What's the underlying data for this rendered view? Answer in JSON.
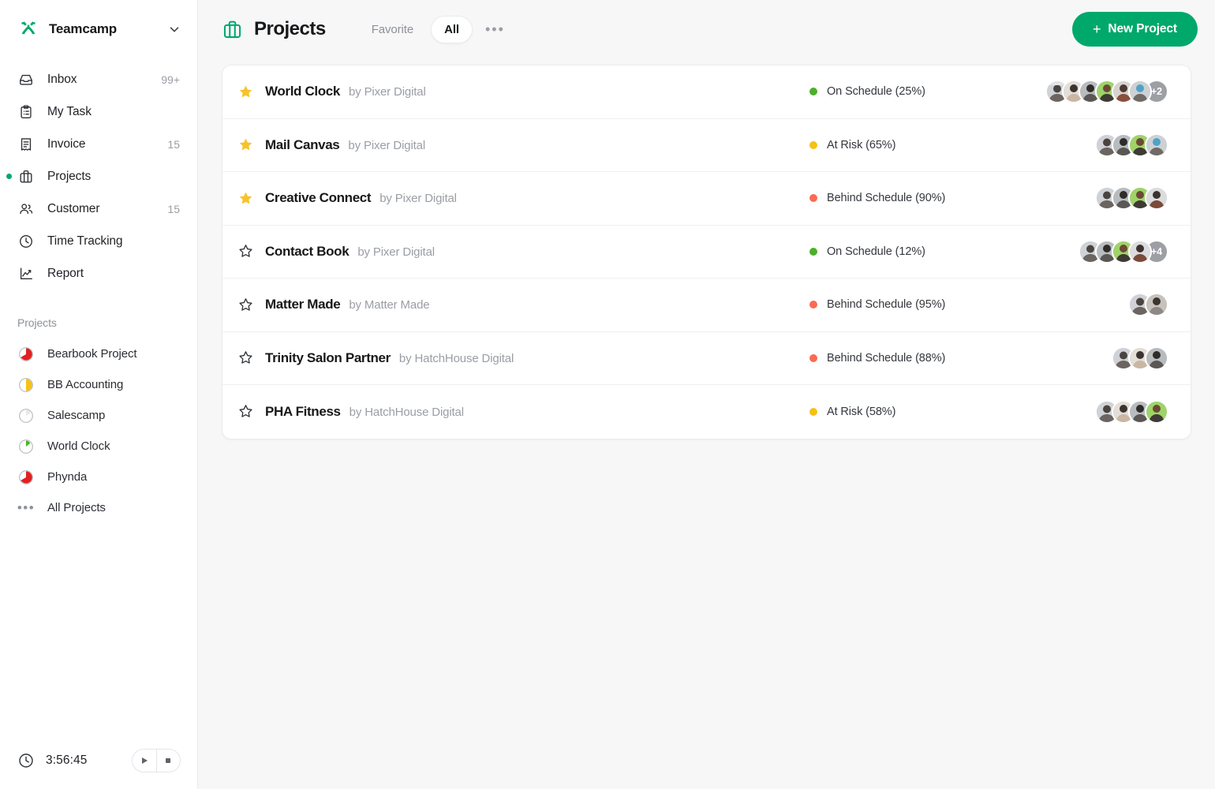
{
  "brand": {
    "name": "Teamcamp",
    "logo_icon": "teamcamp-logo-icon",
    "caret_icon": "chevron-down-icon"
  },
  "sidebar": {
    "nav": [
      {
        "label": "Inbox",
        "icon": "inbox-icon",
        "badge": "99+",
        "active": false
      },
      {
        "label": "My Task",
        "icon": "clipboard-icon",
        "badge": "",
        "active": false
      },
      {
        "label": "Invoice",
        "icon": "receipt-icon",
        "badge": "15",
        "active": false
      },
      {
        "label": "Projects",
        "icon": "briefcase-icon",
        "badge": "",
        "active": true
      },
      {
        "label": "Customer",
        "icon": "people-icon",
        "badge": "15",
        "active": false
      },
      {
        "label": "Time Tracking",
        "icon": "clock-icon",
        "badge": "",
        "active": false
      },
      {
        "label": "Report",
        "icon": "chart-line-icon",
        "badge": "",
        "active": false
      }
    ],
    "projects_section_title": "Projects",
    "projects": [
      {
        "label": "Bearbook Project",
        "icon": "progress-pie-icon",
        "progress": 70,
        "color": "#e02020"
      },
      {
        "label": "BB Accounting",
        "icon": "progress-pie-icon",
        "progress": 45,
        "color": "#f5c116"
      },
      {
        "label": "Salescamp",
        "icon": "progress-pie-icon",
        "progress": 22,
        "color": "#e6e8ea"
      },
      {
        "label": "World Clock",
        "icon": "progress-pie-icon",
        "progress": 25,
        "color": "#45b81f"
      },
      {
        "label": "Phynda",
        "icon": "progress-pie-icon",
        "progress": 70,
        "color": "#e02020"
      }
    ],
    "all_projects_label": "All Projects",
    "all_projects_icon": "ellipsis-icon"
  },
  "timer": {
    "clock_icon": "clock-icon",
    "value": "3:56:45",
    "play_icon": "play-icon",
    "stop_icon": "stop-icon"
  },
  "header": {
    "icon": "briefcase-icon",
    "title": "Projects",
    "tabs": [
      {
        "label": "Favorite",
        "active": false
      },
      {
        "label": "All",
        "active": true
      }
    ],
    "more_icon": "ellipsis-icon",
    "new_project_label": "New Project",
    "new_project_plus": "+",
    "accent_color": "#00a86b"
  },
  "status_colors": {
    "on_schedule": "#4caf28",
    "at_risk": "#f5c116",
    "behind_schedule": "#fa6b52"
  },
  "projects_list": [
    {
      "name": "World Clock",
      "by": "by Pixer Digital",
      "favorite": true,
      "star_icon": "star-filled-icon",
      "status": "On Schedule (25%)",
      "status_color": "#4caf28",
      "avatars": 6,
      "more_avatars": "+2"
    },
    {
      "name": "Mail Canvas",
      "by": "by Pixer Digital",
      "favorite": true,
      "star_icon": "star-filled-icon",
      "status": "At Risk (65%)",
      "status_color": "#f5c116",
      "avatars": 4,
      "more_avatars": ""
    },
    {
      "name": "Creative Connect",
      "by": "by Pixer Digital",
      "favorite": true,
      "star_icon": "star-filled-icon",
      "status": "Behind Schedule (90%)",
      "status_color": "#fa6b52",
      "avatars": 4,
      "more_avatars": ""
    },
    {
      "name": "Contact Book",
      "by": "by Pixer Digital",
      "favorite": false,
      "star_icon": "star-outline-icon",
      "status": "On Schedule (12%)",
      "status_color": "#4caf28",
      "avatars": 4,
      "more_avatars": "+4"
    },
    {
      "name": "Matter Made",
      "by": "by Matter Made",
      "favorite": false,
      "star_icon": "star-outline-icon",
      "status": "Behind Schedule (95%)",
      "status_color": "#fa6b52",
      "avatars": 2,
      "more_avatars": ""
    },
    {
      "name": "Trinity Salon Partner",
      "by": "by HatchHouse Digital",
      "favorite": false,
      "star_icon": "star-outline-icon",
      "status": "Behind Schedule (88%)",
      "status_color": "#fa6b52",
      "avatars": 3,
      "more_avatars": ""
    },
    {
      "name": "PHA Fitness",
      "by": "by HatchHouse Digital",
      "favorite": false,
      "star_icon": "star-outline-icon",
      "status": "At Risk (58%)",
      "status_color": "#f5c116",
      "avatars": 4,
      "more_avatars": ""
    }
  ]
}
